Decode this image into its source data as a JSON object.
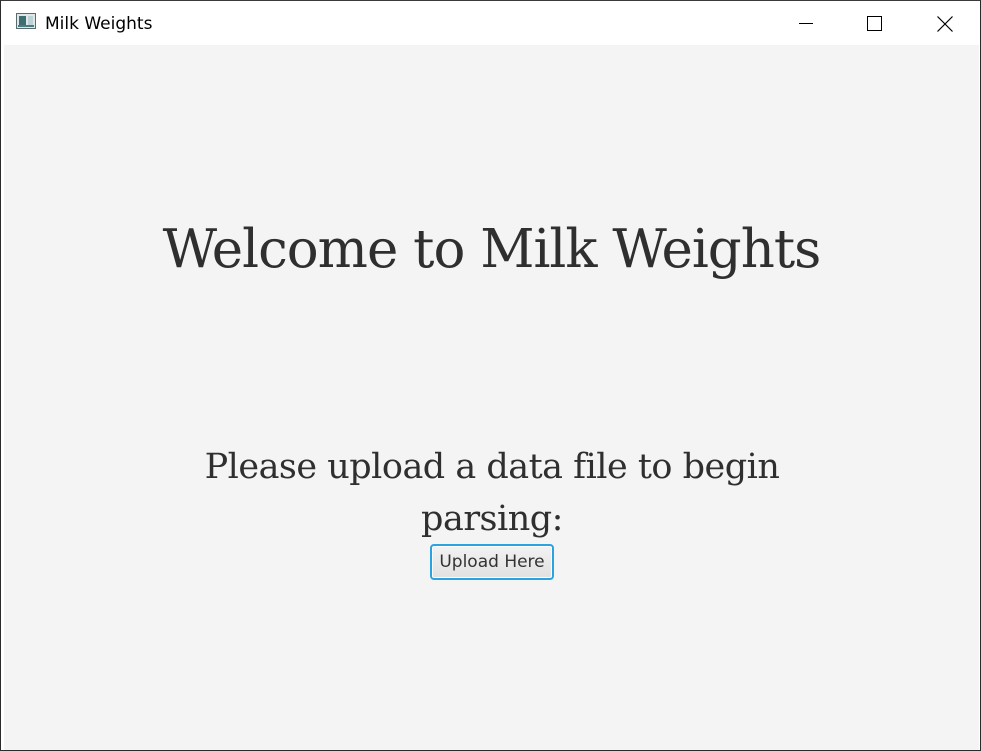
{
  "window": {
    "title": "Milk Weights",
    "controls": {
      "minimize": "minimize-icon",
      "maximize": "maximize-icon",
      "close": "close-icon"
    }
  },
  "main": {
    "welcome_text": "Welcome to Milk Weights",
    "prompt_text": "Please upload a data file to begin parsing:",
    "upload_button_label": "Upload Here"
  },
  "colors": {
    "content_background": "#f4f4f4",
    "text": "#2f2f2f",
    "button_focus_border": "#2aa3e0"
  }
}
